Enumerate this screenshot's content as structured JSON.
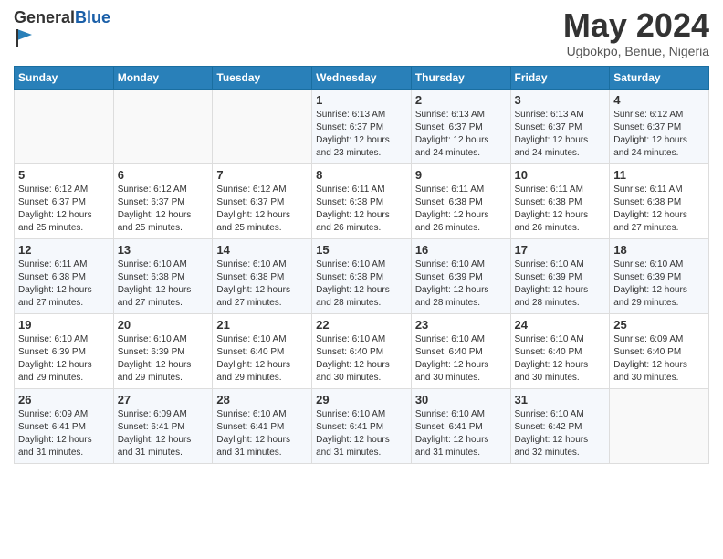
{
  "header": {
    "logo_general": "General",
    "logo_blue": "Blue",
    "month_year": "May 2024",
    "location": "Ugbokpo, Benue, Nigeria"
  },
  "weekdays": [
    "Sunday",
    "Monday",
    "Tuesday",
    "Wednesday",
    "Thursday",
    "Friday",
    "Saturday"
  ],
  "weeks": [
    [
      {
        "day": "",
        "sunrise": "",
        "sunset": "",
        "daylight": ""
      },
      {
        "day": "",
        "sunrise": "",
        "sunset": "",
        "daylight": ""
      },
      {
        "day": "",
        "sunrise": "",
        "sunset": "",
        "daylight": ""
      },
      {
        "day": "1",
        "sunrise": "Sunrise: 6:13 AM",
        "sunset": "Sunset: 6:37 PM",
        "daylight": "Daylight: 12 hours and 23 minutes."
      },
      {
        "day": "2",
        "sunrise": "Sunrise: 6:13 AM",
        "sunset": "Sunset: 6:37 PM",
        "daylight": "Daylight: 12 hours and 24 minutes."
      },
      {
        "day": "3",
        "sunrise": "Sunrise: 6:13 AM",
        "sunset": "Sunset: 6:37 PM",
        "daylight": "Daylight: 12 hours and 24 minutes."
      },
      {
        "day": "4",
        "sunrise": "Sunrise: 6:12 AM",
        "sunset": "Sunset: 6:37 PM",
        "daylight": "Daylight: 12 hours and 24 minutes."
      }
    ],
    [
      {
        "day": "5",
        "sunrise": "Sunrise: 6:12 AM",
        "sunset": "Sunset: 6:37 PM",
        "daylight": "Daylight: 12 hours and 25 minutes."
      },
      {
        "day": "6",
        "sunrise": "Sunrise: 6:12 AM",
        "sunset": "Sunset: 6:37 PM",
        "daylight": "Daylight: 12 hours and 25 minutes."
      },
      {
        "day": "7",
        "sunrise": "Sunrise: 6:12 AM",
        "sunset": "Sunset: 6:37 PM",
        "daylight": "Daylight: 12 hours and 25 minutes."
      },
      {
        "day": "8",
        "sunrise": "Sunrise: 6:11 AM",
        "sunset": "Sunset: 6:38 PM",
        "daylight": "Daylight: 12 hours and 26 minutes."
      },
      {
        "day": "9",
        "sunrise": "Sunrise: 6:11 AM",
        "sunset": "Sunset: 6:38 PM",
        "daylight": "Daylight: 12 hours and 26 minutes."
      },
      {
        "day": "10",
        "sunrise": "Sunrise: 6:11 AM",
        "sunset": "Sunset: 6:38 PM",
        "daylight": "Daylight: 12 hours and 26 minutes."
      },
      {
        "day": "11",
        "sunrise": "Sunrise: 6:11 AM",
        "sunset": "Sunset: 6:38 PM",
        "daylight": "Daylight: 12 hours and 27 minutes."
      }
    ],
    [
      {
        "day": "12",
        "sunrise": "Sunrise: 6:11 AM",
        "sunset": "Sunset: 6:38 PM",
        "daylight": "Daylight: 12 hours and 27 minutes."
      },
      {
        "day": "13",
        "sunrise": "Sunrise: 6:10 AM",
        "sunset": "Sunset: 6:38 PM",
        "daylight": "Daylight: 12 hours and 27 minutes."
      },
      {
        "day": "14",
        "sunrise": "Sunrise: 6:10 AM",
        "sunset": "Sunset: 6:38 PM",
        "daylight": "Daylight: 12 hours and 27 minutes."
      },
      {
        "day": "15",
        "sunrise": "Sunrise: 6:10 AM",
        "sunset": "Sunset: 6:38 PM",
        "daylight": "Daylight: 12 hours and 28 minutes."
      },
      {
        "day": "16",
        "sunrise": "Sunrise: 6:10 AM",
        "sunset": "Sunset: 6:39 PM",
        "daylight": "Daylight: 12 hours and 28 minutes."
      },
      {
        "day": "17",
        "sunrise": "Sunrise: 6:10 AM",
        "sunset": "Sunset: 6:39 PM",
        "daylight": "Daylight: 12 hours and 28 minutes."
      },
      {
        "day": "18",
        "sunrise": "Sunrise: 6:10 AM",
        "sunset": "Sunset: 6:39 PM",
        "daylight": "Daylight: 12 hours and 29 minutes."
      }
    ],
    [
      {
        "day": "19",
        "sunrise": "Sunrise: 6:10 AM",
        "sunset": "Sunset: 6:39 PM",
        "daylight": "Daylight: 12 hours and 29 minutes."
      },
      {
        "day": "20",
        "sunrise": "Sunrise: 6:10 AM",
        "sunset": "Sunset: 6:39 PM",
        "daylight": "Daylight: 12 hours and 29 minutes."
      },
      {
        "day": "21",
        "sunrise": "Sunrise: 6:10 AM",
        "sunset": "Sunset: 6:40 PM",
        "daylight": "Daylight: 12 hours and 29 minutes."
      },
      {
        "day": "22",
        "sunrise": "Sunrise: 6:10 AM",
        "sunset": "Sunset: 6:40 PM",
        "daylight": "Daylight: 12 hours and 30 minutes."
      },
      {
        "day": "23",
        "sunrise": "Sunrise: 6:10 AM",
        "sunset": "Sunset: 6:40 PM",
        "daylight": "Daylight: 12 hours and 30 minutes."
      },
      {
        "day": "24",
        "sunrise": "Sunrise: 6:10 AM",
        "sunset": "Sunset: 6:40 PM",
        "daylight": "Daylight: 12 hours and 30 minutes."
      },
      {
        "day": "25",
        "sunrise": "Sunrise: 6:09 AM",
        "sunset": "Sunset: 6:40 PM",
        "daylight": "Daylight: 12 hours and 30 minutes."
      }
    ],
    [
      {
        "day": "26",
        "sunrise": "Sunrise: 6:09 AM",
        "sunset": "Sunset: 6:41 PM",
        "daylight": "Daylight: 12 hours and 31 minutes."
      },
      {
        "day": "27",
        "sunrise": "Sunrise: 6:09 AM",
        "sunset": "Sunset: 6:41 PM",
        "daylight": "Daylight: 12 hours and 31 minutes."
      },
      {
        "day": "28",
        "sunrise": "Sunrise: 6:10 AM",
        "sunset": "Sunset: 6:41 PM",
        "daylight": "Daylight: 12 hours and 31 minutes."
      },
      {
        "day": "29",
        "sunrise": "Sunrise: 6:10 AM",
        "sunset": "Sunset: 6:41 PM",
        "daylight": "Daylight: 12 hours and 31 minutes."
      },
      {
        "day": "30",
        "sunrise": "Sunrise: 6:10 AM",
        "sunset": "Sunset: 6:41 PM",
        "daylight": "Daylight: 12 hours and 31 minutes."
      },
      {
        "day": "31",
        "sunrise": "Sunrise: 6:10 AM",
        "sunset": "Sunset: 6:42 PM",
        "daylight": "Daylight: 12 hours and 32 minutes."
      },
      {
        "day": "",
        "sunrise": "",
        "sunset": "",
        "daylight": ""
      }
    ]
  ]
}
